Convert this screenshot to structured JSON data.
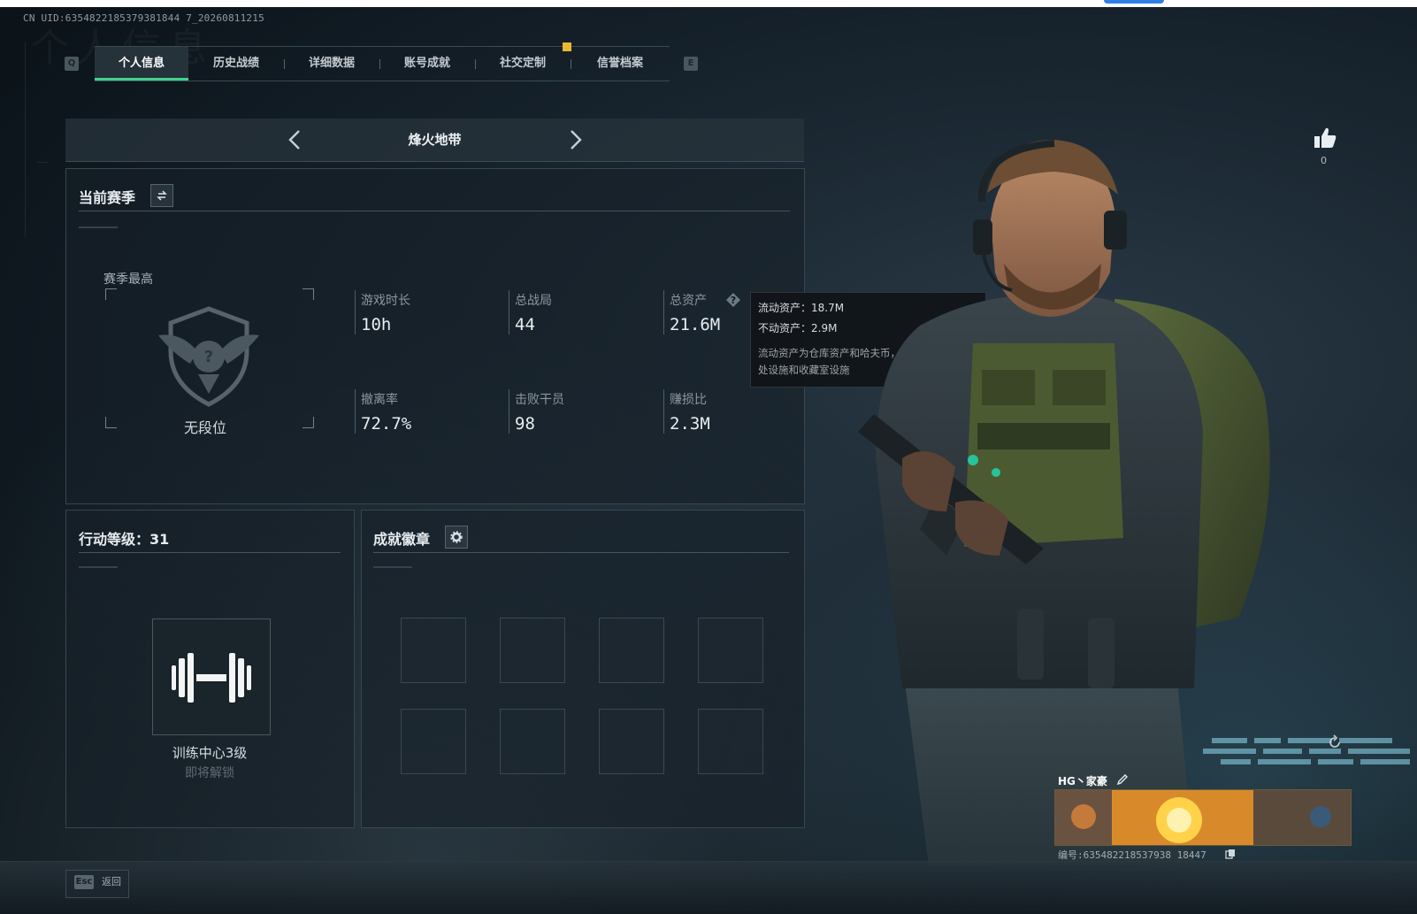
{
  "header": {
    "uid_text": "CN UID:6354822185379381844 7_20260811215",
    "watermark_text": "个人信息"
  },
  "tabs": [
    {
      "label": "个人信息",
      "active": true
    },
    {
      "label": "历史战绩",
      "active": false
    },
    {
      "label": "详细数据",
      "active": false
    },
    {
      "label": "账号成就",
      "active": false
    },
    {
      "label": "社交定制",
      "active": false
    },
    {
      "label": "信誉档案",
      "active": false
    }
  ],
  "tab_keys": {
    "left": "Q",
    "right": "E"
  },
  "map_selector": {
    "name": "烽火地带"
  },
  "season": {
    "title": "当前赛季",
    "rank_caption": "赛季最高",
    "rank_name": "无段位",
    "stats": [
      {
        "label": "游戏时长",
        "value": "10h"
      },
      {
        "label": "总战局",
        "value": "44"
      },
      {
        "label": "总资产",
        "value": "21.6M"
      },
      {
        "label": "撤离率",
        "value": "72.7%"
      },
      {
        "label": "击败干员",
        "value": "98"
      },
      {
        "label": "赚损比",
        "value": "2.3M"
      }
    ]
  },
  "tooltip": {
    "liquid": "流动资产：18.7M",
    "fixed": "不动资产：2.9M",
    "description": "流动资产为仓库资产和哈夫币，不动资产为特勤处设施和收藏室设施"
  },
  "action_level": {
    "title": "行动等级：31",
    "training_label": "训练中心3级",
    "training_status": "即将解锁"
  },
  "achievements": {
    "title": "成就徽章",
    "slot_count": 8
  },
  "likes": {
    "count": "0"
  },
  "nameplate": {
    "name": "HG丶家豪",
    "id_text": "编号:635482218537938 18447"
  },
  "footer": {
    "esc_key": "Esc",
    "esc_label": "返回"
  },
  "colors": {
    "accent_green": "#41d18c",
    "tab_marker": "#e8b832"
  }
}
